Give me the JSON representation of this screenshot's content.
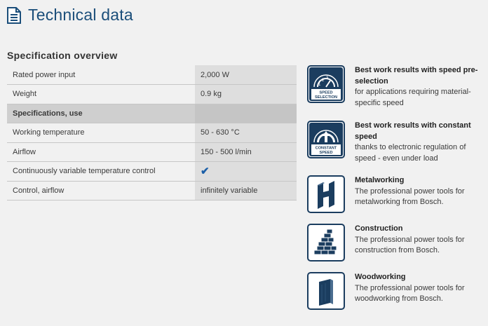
{
  "header": {
    "title": "Technical data"
  },
  "spec": {
    "section_title": "Specification overview",
    "rows": [
      {
        "label": "Rated power input",
        "value": "2,000 W"
      },
      {
        "label": "Weight",
        "value": "0.9 kg"
      },
      {
        "label": "Specifications, use",
        "value": ""
      },
      {
        "label": "Working temperature",
        "value": "50 - 630 °C"
      },
      {
        "label": "Airflow",
        "value": "150 - 500 l/min"
      },
      {
        "label": "Continuously variable temperature control",
        "value": "✔"
      },
      {
        "label": "Control, airflow",
        "value": "infinitely variable"
      }
    ]
  },
  "features": [
    {
      "icon": "speed-selection-icon",
      "icon_text": "SPEED SELECTION",
      "title": "Best work results with speed pre-selection",
      "desc": "for applications requiring material-specific speed"
    },
    {
      "icon": "constant-speed-icon",
      "icon_text": "CONSTANT SPEED",
      "title": "Best work results with constant speed",
      "desc": "thanks to electronic regulation of speed - even under load"
    },
    {
      "icon": "metalworking-icon",
      "title": "Metalworking",
      "desc": "The professional power tools for metalworking from Bosch."
    },
    {
      "icon": "construction-icon",
      "title": "Construction",
      "desc": "The professional power tools for construction from Bosch."
    },
    {
      "icon": "woodworking-icon",
      "title": "Woodworking",
      "desc": "The professional power tools for woodworking from Bosch."
    }
  ],
  "colors": {
    "title": "#1b4e7a",
    "icon_dark": "#1b3d5f",
    "check": "#1b5fa8"
  }
}
